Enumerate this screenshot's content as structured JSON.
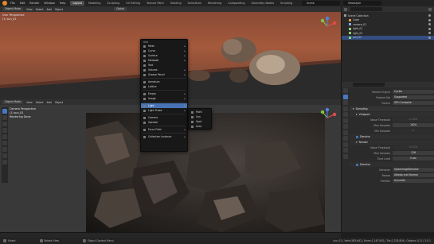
{
  "topbar": {
    "menus": [
      "File",
      "Edit",
      "Render",
      "Window",
      "Help"
    ],
    "workspaces": [
      "Layout",
      "Modeling",
      "Sculpting",
      "UV Editing",
      "Texture Paint",
      "Shading",
      "Animation",
      "Rendering",
      "Compositing",
      "Geometry Nodes",
      "Scripting"
    ],
    "active_workspace": "Layout",
    "scene": "Scene",
    "view_layer": "ViewLayer"
  },
  "top_viewport": {
    "mode": "Object Mode",
    "menus": [
      "View",
      "Select",
      "Add",
      "Object"
    ],
    "transform": "Global",
    "overlay_title": "User Perspective",
    "overlay_sub": "(1) sun_01"
  },
  "bottom_viewport": {
    "mode": "Object Mode",
    "menus": [
      "View",
      "Select",
      "Add",
      "Object"
    ],
    "overlay_title": "Camera Perspective",
    "overlay_sub": "(1) sun_01",
    "overlay_status": "Rendering Done"
  },
  "add_menu": {
    "header": "Add",
    "items": [
      {
        "label": "Mesh",
        "sub": true
      },
      {
        "label": "Curve",
        "sub": true
      },
      {
        "label": "Surface",
        "sub": true
      },
      {
        "label": "Metaball",
        "sub": true
      },
      {
        "label": "Text",
        "sub": false
      },
      {
        "label": "Volume",
        "sub": true
      },
      {
        "label": "Grease Pencil",
        "sub": true
      },
      {
        "label": "Armature",
        "sub": false
      },
      {
        "label": "Lattice",
        "sub": false
      },
      {
        "label": "Empty",
        "sub": true
      },
      {
        "label": "Image",
        "sub": true
      },
      {
        "label": "Light",
        "sub": true,
        "highlighted": true
      },
      {
        "label": "Light Probe",
        "sub": true
      },
      {
        "label": "Camera",
        "sub": false
      },
      {
        "label": "Speaker",
        "sub": false
      },
      {
        "label": "Force Field",
        "sub": true
      },
      {
        "label": "Collection Instance",
        "sub": true
      }
    ]
  },
  "light_submenu": {
    "items": [
      "Point",
      "Sun",
      "Spot",
      "Area"
    ],
    "highlighted": "Sun"
  },
  "outliner": {
    "root": "Scene Collection",
    "rows": [
      {
        "name": "Scene Collection",
        "color": "#9a9a9a",
        "selected": false,
        "indent": 0
      },
      {
        "name": "Cube",
        "color": "#e49b3a",
        "selected": false,
        "indent": 1
      },
      {
        "name": "camera_01",
        "color": "#7db1e3",
        "selected": false,
        "indent": 1
      },
      {
        "name": "light_01",
        "color": "#8fd36e",
        "selected": false,
        "indent": 1
      },
      {
        "name": "light_02",
        "color": "#8fd36e",
        "selected": false,
        "indent": 1
      },
      {
        "name": "sun_01",
        "color": "#8fd36e",
        "selected": true,
        "indent": 1
      }
    ]
  },
  "properties": {
    "search_placeholder": "",
    "render_engine_label": "Render Engine",
    "render_engine": "Cycles",
    "feature_set_label": "Feature Set",
    "feature_set": "Supported",
    "device_label": "Device",
    "device": "GPU Compute",
    "sampling_section": "Sampling",
    "viewport_section": "Viewport",
    "vp_noise_label": "Noise Threshold",
    "vp_noise": "0.1000",
    "vp_max_samples_label": "Max Samples",
    "vp_max_samples": "1024",
    "vp_min_samples_label": "Min Samples",
    "vp_min_samples": "0",
    "vp_denoise_label": "Denoise",
    "render_section": "Render",
    "r_noise_label": "Noise Threshold",
    "r_noise": "0.0100",
    "r_max_samples_label": "Max Samples",
    "r_max_samples": "128",
    "r_time_label": "Time Limit",
    "r_time": "0 sec",
    "r_denoise_label": "Denoise",
    "denoiser_label": "Denoiser",
    "denoiser": "OpenImageDenoise",
    "passes_label": "Passes",
    "passes": "Albedo and Normal",
    "prefilter_label": "Prefilter",
    "prefilter": "Accurate"
  },
  "status": {
    "left": "Select",
    "mid": "Rotate View",
    "mid2": "Object Context Menu",
    "right": "sun_01 | Verts:585,642 | Faces:1,167,902 | Tris:2,335,804 | Objects:1/11 | 3.5.1"
  },
  "colors": {
    "accent": "#4772b3",
    "logo": "#e08b2a"
  }
}
